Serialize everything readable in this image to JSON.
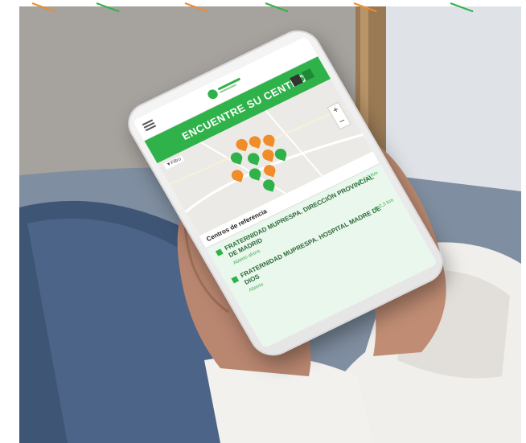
{
  "app": {
    "banner_title": "ENCUENTRE SU CENTRO",
    "map_filter": "▼Filtro",
    "zoom_in": "+",
    "zoom_out": "–",
    "list_heading": "Centros de referencia",
    "items": [
      {
        "title": "FRATERNIDAD MUPRESPA. DIRECCIÓN PROVINCIAL DE MADRID",
        "distance": "▼ 2,3 Km",
        "hours": "Abierto ahora"
      },
      {
        "title": "FRATERNIDAD MUPRESPA. HOSPITAL MADRE DE DIOS",
        "distance": "▼ 2,3 Km",
        "hours": "Abierto"
      }
    ]
  },
  "colors": {
    "brand_green": "#2fb24a",
    "pin_orange": "#f08c2a",
    "list_bg": "#e9f7ec"
  },
  "icons": [
    "menu-icon",
    "logo-icon",
    "map-pin-icon",
    "zoom-in-icon",
    "zoom-out-icon",
    "square-marker-icon"
  ]
}
